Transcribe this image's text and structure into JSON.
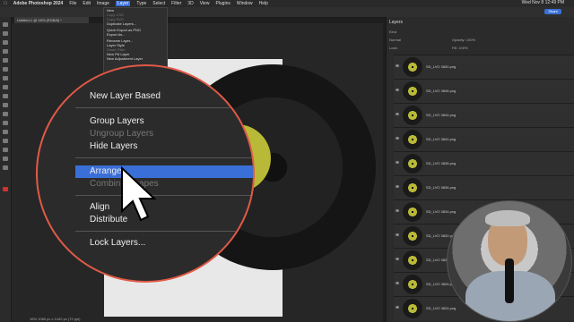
{
  "menubar": {
    "app": "Adobe Photoshop 2024",
    "items": [
      "File",
      "Edit",
      "Image",
      "Layer",
      "Type",
      "Select",
      "Filter",
      "3D",
      "View",
      "Plugins",
      "Window",
      "Help"
    ],
    "active": "Layer",
    "clock": "Wed Nov 8  12:49 PM"
  },
  "options": {
    "share_label": "Share"
  },
  "doc_tab": "Untitled-1 @ 16% (RGB/8) *",
  "layer_menu": {
    "items": [
      {
        "label": "New",
        "dim": false
      },
      {
        "label": "Copy CSS",
        "dim": true
      },
      {
        "label": "Copy SVG",
        "dim": true
      },
      {
        "label": "Duplicate Layers...",
        "dim": false
      },
      {
        "label": "",
        "dim": false,
        "sep": true
      },
      {
        "label": "Quick Export as PNG",
        "dim": false
      },
      {
        "label": "Export As...",
        "dim": false
      },
      {
        "label": "",
        "dim": false,
        "sep": true
      },
      {
        "label": "Rename Layer...",
        "dim": false
      },
      {
        "label": "Layer Style",
        "dim": false
      },
      {
        "label": "Smart Filter",
        "dim": true
      },
      {
        "label": "New Fill Layer",
        "dim": false
      },
      {
        "label": "New Adjustment Layer",
        "dim": false
      }
    ]
  },
  "zoom_menu": {
    "new_layer_based": "New Layer Based",
    "group": "Group Layers",
    "ungroup": "Ungroup Layers",
    "hide": "Hide Layers",
    "arrange": "Arrange",
    "combine": "Combine Shapes",
    "align": "Align",
    "distribute": "Distribute",
    "lock": "Lock Layers..."
  },
  "layers_panel": {
    "tab": "Layers",
    "kind": "Kind",
    "mode": "Normal",
    "opacity": "Opacity: 100%",
    "lock": "Lock:",
    "fill": "Fill: 100%",
    "layers": [
      "SD_LVO 3830.png",
      "SD_LVO 3846.png",
      "SD_LVO 3844.png",
      "SD_LVO 3840.png",
      "SD_LVO 3838.png",
      "SD_LVO 3836.png",
      "SD_LVO 3834.png",
      "SD_LVO 3832.png",
      "SD_LVO 3828.png",
      "SD_LVO 3826.png",
      "SD_LVO 3824.png"
    ]
  },
  "status": "16%   1080 px x 1440 px (72 ppi)"
}
